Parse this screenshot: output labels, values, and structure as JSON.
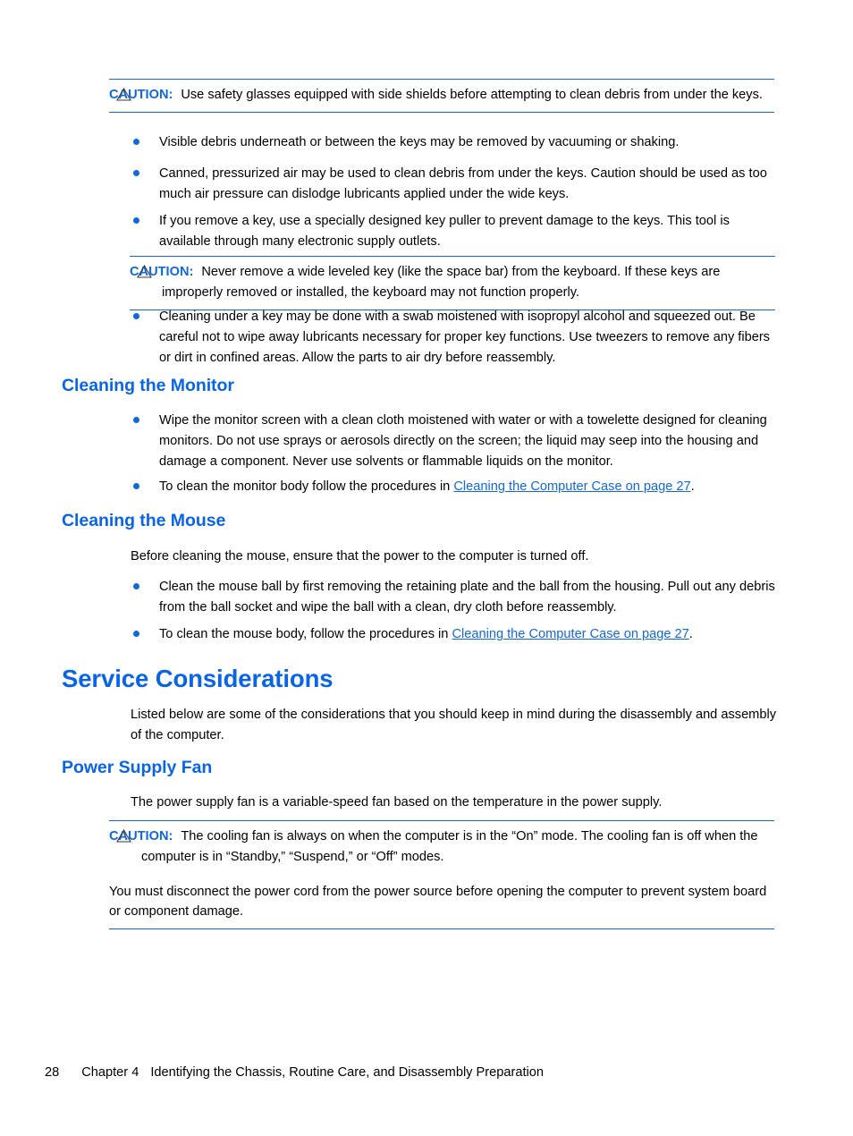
{
  "page": {
    "number": "28",
    "chapter": "Chapter 4",
    "chapter_title": "Identifying the Chassis, Routine Care, and Disassembly Preparation"
  },
  "colors": {
    "accent_blue": "#1168d8",
    "heading_blue": "#0a64e6",
    "text_black": "#000000",
    "background": "#ffffff"
  },
  "caution_label": "CAUTION:",
  "cautions": {
    "safety_glasses": {
      "label": "CAUTION:",
      "text": "Use safety glasses equipped with side shields before attempting to clean debris from under the keys."
    },
    "wide_key": {
      "label": "CAUTION:",
      "text": "Never remove a wide leveled key (like the space bar) from the keyboard. If these keys are improperly removed or installed, the keyboard may not function properly."
    },
    "cooling_fan": {
      "label": "CAUTION:",
      "text": "The cooling fan is always on when the computer is in the “On” mode. The cooling fan is off when the computer is in “Standby,” “Suspend,” or “Off” modes.",
      "second_paragraph": "You must disconnect the power cord from the power source before opening the computer to prevent system board or component damage."
    }
  },
  "keyboard_bullets": [
    "Visible debris underneath or between the keys may be removed by vacuuming or shaking.",
    "Canned, pressurized air may be used to clean debris from under the keys. Caution should be used as too much air pressure can dislodge lubricants applied under the wide keys.",
    "If you remove a key, use a specially designed key puller to prevent damage to the keys. This tool is available through many electronic supply outlets.",
    "Cleaning under a key may be done with a swab moistened with isopropyl alcohol and squeezed out. Be careful not to wipe away lubricants necessary for proper key functions. Use tweezers to remove any fibers or dirt in confined areas. Allow the parts to air dry before reassembly."
  ],
  "sections": {
    "cleaning_monitor": {
      "heading": "Cleaning the Monitor",
      "bullet_1": "Wipe the monitor screen with a clean cloth moistened with water or with a towelette designed for cleaning monitors. Do not use sprays or aerosols directly on the screen; the liquid may seep into the housing and damage a component. Never use solvents or flammable liquids on the monitor.",
      "bullet_2_pre": "To clean the monitor body follow the procedures in ",
      "bullet_2_link": "Cleaning the Computer Case on page 27",
      "bullet_2_post": "."
    },
    "cleaning_mouse": {
      "heading": "Cleaning the Mouse",
      "intro": "Before cleaning the mouse, ensure that the power to the computer is turned off.",
      "bullet_1": "Clean the mouse ball by first removing the retaining plate and the ball from the housing. Pull out any debris from the ball socket and wipe the ball with a clean, dry cloth before reassembly.",
      "bullet_2_pre": "To clean the mouse body, follow the procedures in ",
      "bullet_2_link": "Cleaning the Computer Case on page 27",
      "bullet_2_post": "."
    },
    "service_considerations": {
      "heading": "Service Considerations",
      "intro": "Listed below are some of the considerations that you should keep in mind during the disassembly and assembly of the computer."
    },
    "power_supply_fan": {
      "heading": "Power Supply Fan",
      "intro": "The power supply fan is a variable-speed fan based on the temperature in the power supply."
    }
  }
}
